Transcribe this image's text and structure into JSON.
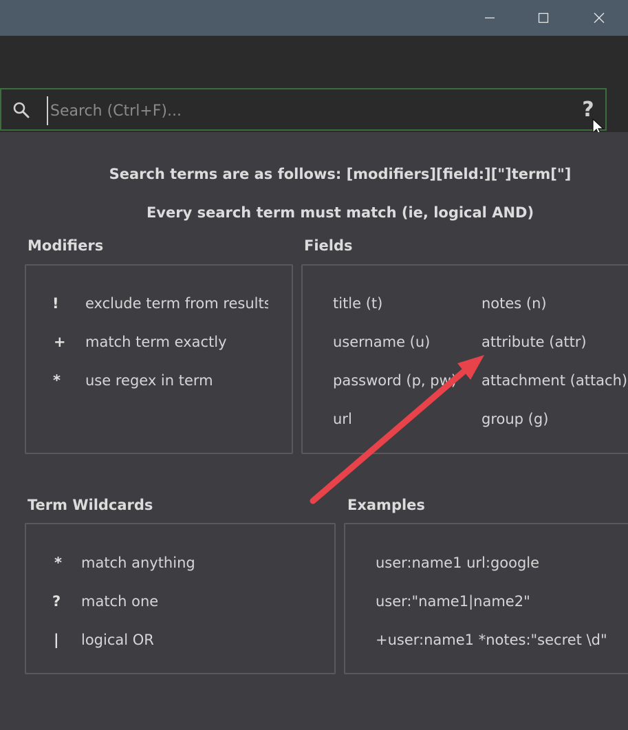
{
  "window_controls": {
    "minimize": "minimize",
    "maximize": "maximize",
    "close": "close"
  },
  "search": {
    "placeholder": "Search (Ctrl+F)...",
    "help_label": "?"
  },
  "help": {
    "line1": "Search terms are as follows: [modifiers][field:][\"]term[\"]",
    "line2": "Every search term must match (ie, logical AND)",
    "modifiers": {
      "title": "Modifiers",
      "items": [
        {
          "symbol": "!",
          "text": "exclude term from results"
        },
        {
          "symbol": "+",
          "text": "match term exactly"
        },
        {
          "symbol": "*",
          "text": "use regex in term"
        }
      ]
    },
    "fields": {
      "title": "Fields",
      "left": [
        "title (t)",
        "username (u)",
        "password (p, pw)",
        "url"
      ],
      "right": [
        "notes (n)",
        "attribute (attr)",
        "attachment (attach)",
        "group (g)"
      ]
    },
    "wildcards": {
      "title": "Term Wildcards",
      "items": [
        {
          "symbol": "*",
          "text": "match anything"
        },
        {
          "symbol": "?",
          "text": "match one"
        },
        {
          "symbol": "|",
          "text": "logical OR"
        }
      ]
    },
    "examples": {
      "title": "Examples",
      "items": [
        "user:name1 url:google",
        "user:\"name1|name2\"",
        "+user:name1 *notes:\"secret \\d\""
      ]
    }
  },
  "colors": {
    "titlebar": "#4d5a68",
    "background": "#2b2b2b",
    "panel": "#3e3e42",
    "search_border": "#3c6e3c",
    "annotation_arrow": "#e8434a"
  }
}
